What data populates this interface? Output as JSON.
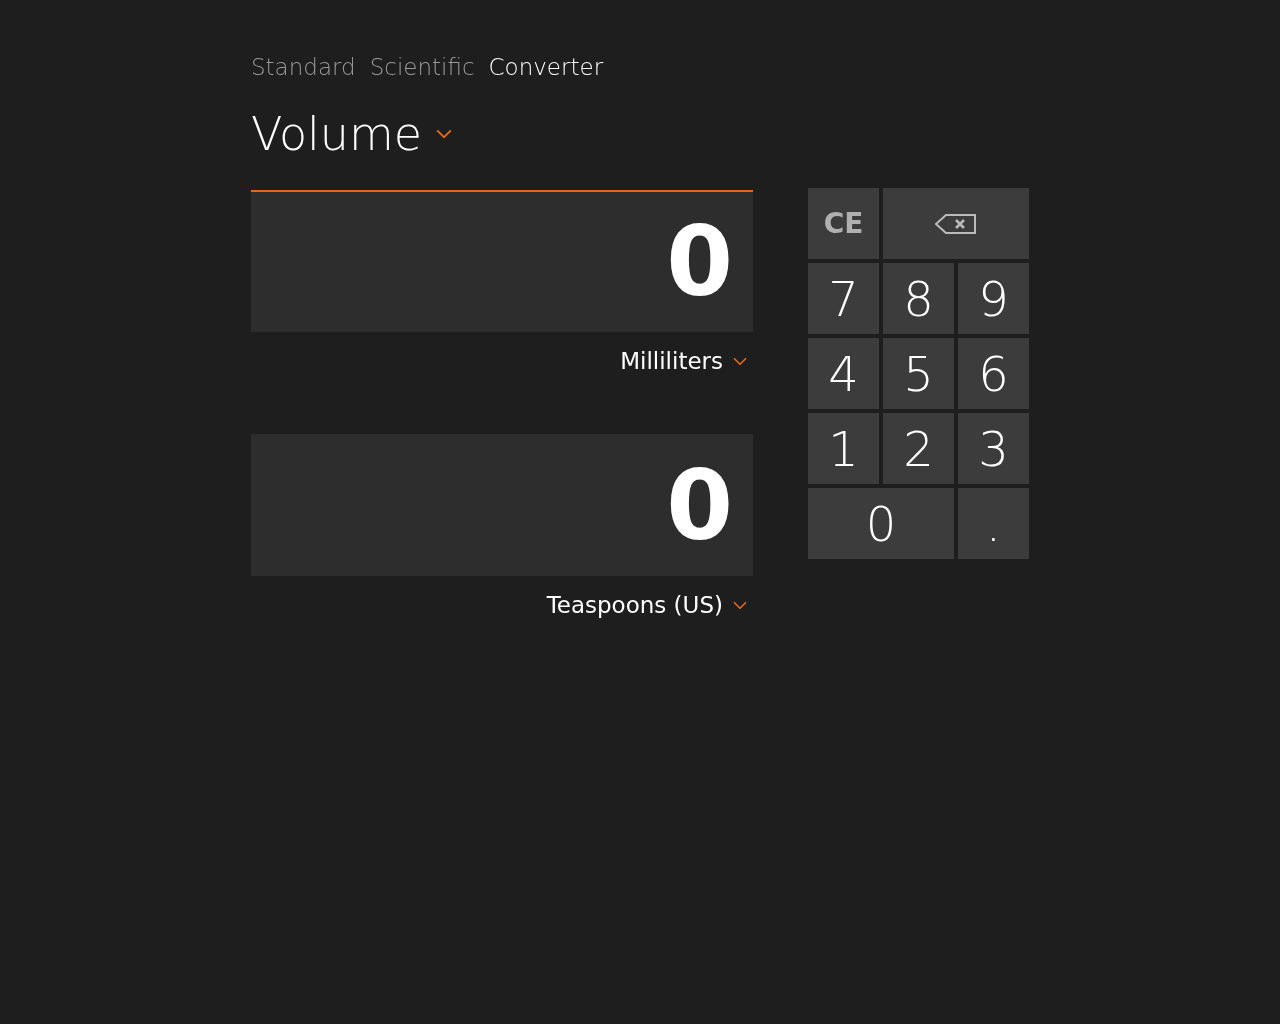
{
  "tabs": [
    {
      "label": "Standard",
      "selected": false
    },
    {
      "label": "Scientific",
      "selected": false
    },
    {
      "label": "Converter",
      "selected": true
    }
  ],
  "category": {
    "label": "Volume"
  },
  "fields": [
    {
      "value": "0",
      "unit": "Milliliters",
      "active": true
    },
    {
      "value": "0",
      "unit": "Teaspoons (US)",
      "active": false
    }
  ],
  "keypad": [
    {
      "kind": "clear",
      "label": "CE",
      "wide": false
    },
    {
      "kind": "backspace",
      "wide": true
    },
    {
      "kind": "digit",
      "label": "7",
      "wide": false
    },
    {
      "kind": "digit",
      "label": "8",
      "wide": false
    },
    {
      "kind": "digit",
      "label": "9",
      "wide": false
    },
    {
      "kind": "digit",
      "label": "4",
      "wide": false
    },
    {
      "kind": "digit",
      "label": "5",
      "wide": false
    },
    {
      "kind": "digit",
      "label": "6",
      "wide": false
    },
    {
      "kind": "digit",
      "label": "1",
      "wide": false
    },
    {
      "kind": "digit",
      "label": "2",
      "wide": false
    },
    {
      "kind": "digit",
      "label": "3",
      "wide": false
    },
    {
      "kind": "digit",
      "label": "0",
      "wide": true
    },
    {
      "kind": "digit",
      "label": ".",
      "wide": false
    }
  ]
}
